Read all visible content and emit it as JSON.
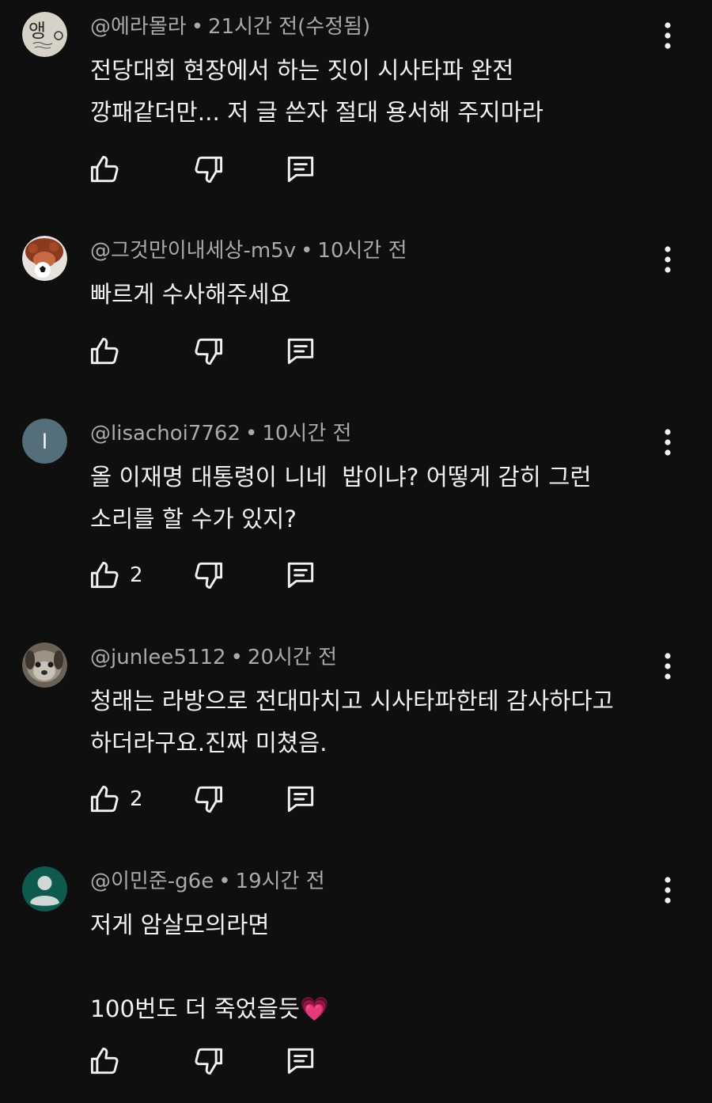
{
  "comments": [
    {
      "author": "@에라몰라",
      "separator": "•",
      "time": "21시간 전(수정됨)",
      "text": "전당대회 현장에서 하는 짓이 시사타파 완전\n깡패같더만... 저 글 쓴자 절대 용서해 주지마라",
      "likes": "",
      "avatar": "avatar-handwriting-logo",
      "avatar_text": "앵"
    },
    {
      "author": "@그것만이내세상-m5v",
      "separator": "•",
      "time": "10시간 전",
      "text": "빠르게 수사해주세요",
      "likes": "",
      "avatar": "avatar-plush-toy"
    },
    {
      "author": "@lisachoi7762",
      "separator": "•",
      "time": "10시간 전",
      "text": "올 이재명 대통령이 니네  밥이냐? 어떻게 감히 그런\n소리를 할 수가 있지?",
      "likes": "2",
      "avatar": "avatar-letter",
      "avatar_letter": "l",
      "avatar_color": "#546e7a"
    },
    {
      "author": "@junlee5112",
      "separator": "•",
      "time": "20시간 전",
      "text": "청래는 라방으로 전대마치고 시사타파한테 감사하다고\n하더라구요.진짜 미쳤음.",
      "likes": "2",
      "avatar": "avatar-dog-photo"
    },
    {
      "author": "@이민준-g6e",
      "separator": "•",
      "time": "19시간 전",
      "text": "저게 암살모의라면\n\n100번도 더 죽었을듯💗",
      "likes": "",
      "avatar": "avatar-default-person",
      "avatar_color": "#0f5a4e"
    }
  ],
  "colors": {
    "background": "#0f0f0f",
    "text": "#f1f1f1",
    "meta": "#aaaaaa"
  },
  "icons": {
    "like": "thumbs-up-icon",
    "dislike": "thumbs-down-icon",
    "reply": "reply-comment-icon",
    "more": "more-vertical-icon"
  }
}
